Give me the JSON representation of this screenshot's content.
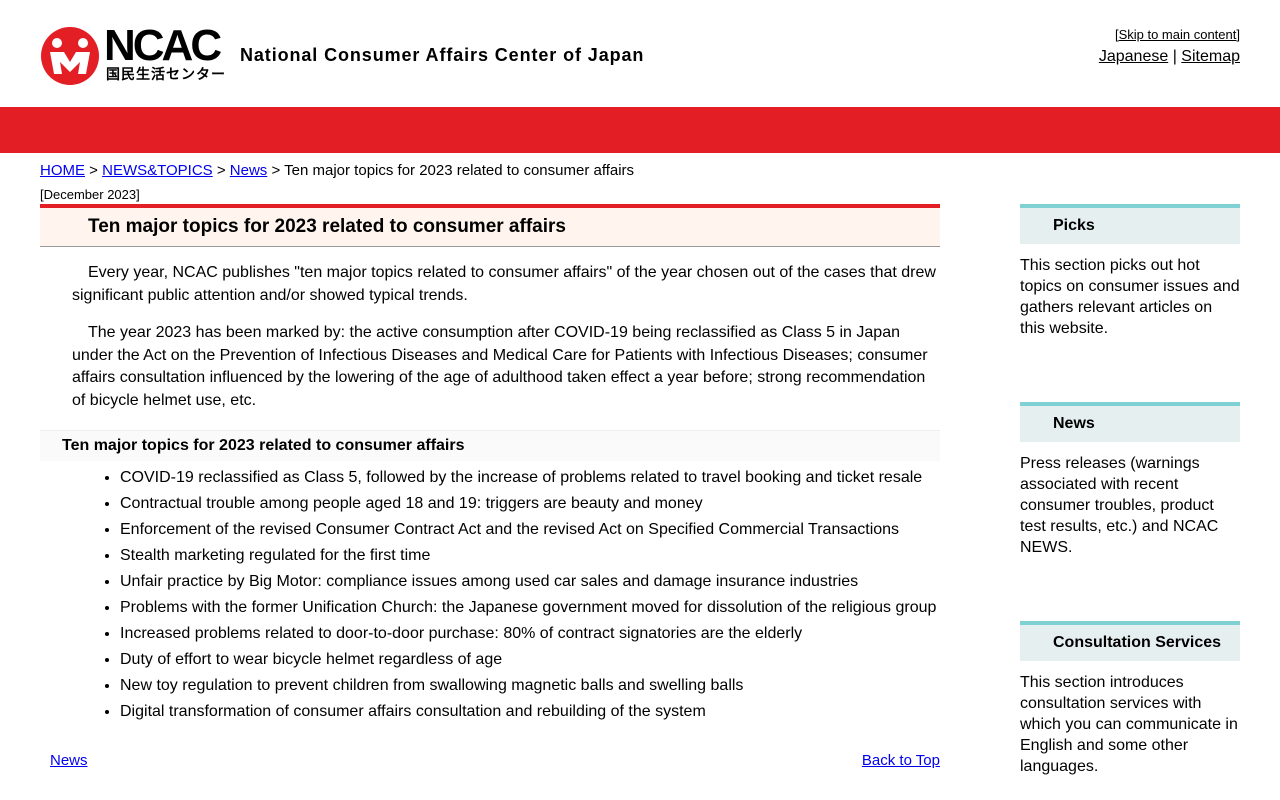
{
  "header": {
    "logo_abbr": "NCAC",
    "logo_ja": "国民生活センター",
    "site_name": "National Consumer Affairs Center of Japan",
    "skip_prefix": "[",
    "skip_link": "Skip to main content",
    "skip_suffix": "]",
    "lang_link": "Japanese",
    "separator": "|",
    "sitemap_link": "Sitemap"
  },
  "breadcrumb": {
    "home": "HOME",
    "sep": ">",
    "news_topics": "NEWS&TOPICS",
    "news": "News",
    "current": "Ten major topics for 2023 related to consumer affairs"
  },
  "date": "[December 2023]",
  "main": {
    "title": "Ten major topics for 2023 related to consumer affairs",
    "paragraph_1": "Every year, NCAC publishes \"ten major topics related to consumer affairs\" of the year chosen out of the cases that drew significant public attention and/or showed typical trends.",
    "paragraph_2": "The year 2023 has been marked by: the active consumption after COVID-19 being reclassified as Class 5 in Japan under the Act on the Prevention of Infectious Diseases and Medical Care for Patients with Infectious Diseases; consumer affairs consultation influenced by the lowering of the age of adulthood taken effect a year before; strong recommendation of bicycle helmet use, etc.",
    "subheading": "Ten major topics for 2023 related to consumer affairs",
    "topics": [
      "COVID-19 reclassified as Class 5, followed by the increase of problems related to travel booking and ticket resale",
      "Contractual trouble among people aged 18 and 19: triggers are beauty and money",
      "Enforcement of the revised Consumer Contract Act and the revised Act on Specified Commercial Transactions",
      "Stealth marketing regulated for the first time",
      "Unfair practice by Big Motor: compliance issues among used car sales and damage insurance industries",
      "Problems with the former Unification Church: the Japanese government moved for dissolution of the religious group",
      "Increased problems related to door-to-door purchase: 80% of contract signatories are the elderly",
      "Duty of effort to wear bicycle helmet regardless of age",
      "New toy regulation to prevent children from swallowing magnetic balls and swelling balls",
      "Digital transformation of consumer affairs consultation and rebuilding of the system"
    ],
    "bottom_news_link": "News",
    "back_to_top": "Back to Top"
  },
  "sidebar": {
    "picks": {
      "title": "Picks",
      "text": "This section picks out hot topics on consumer issues and gathers relevant articles on this website."
    },
    "news": {
      "title": "News",
      "text": "Press releases (warnings associated with recent consumer troubles, product test results, etc.) and NCAC NEWS."
    },
    "consultation": {
      "title": "Consultation Services",
      "text": "This section introduces consultation services with which you can communicate in English and some other languages."
    }
  },
  "colors": {
    "brand_red": "#e31e24",
    "sidebar_accent": "#7fd1d3",
    "title_bg": "#fff5ee"
  }
}
